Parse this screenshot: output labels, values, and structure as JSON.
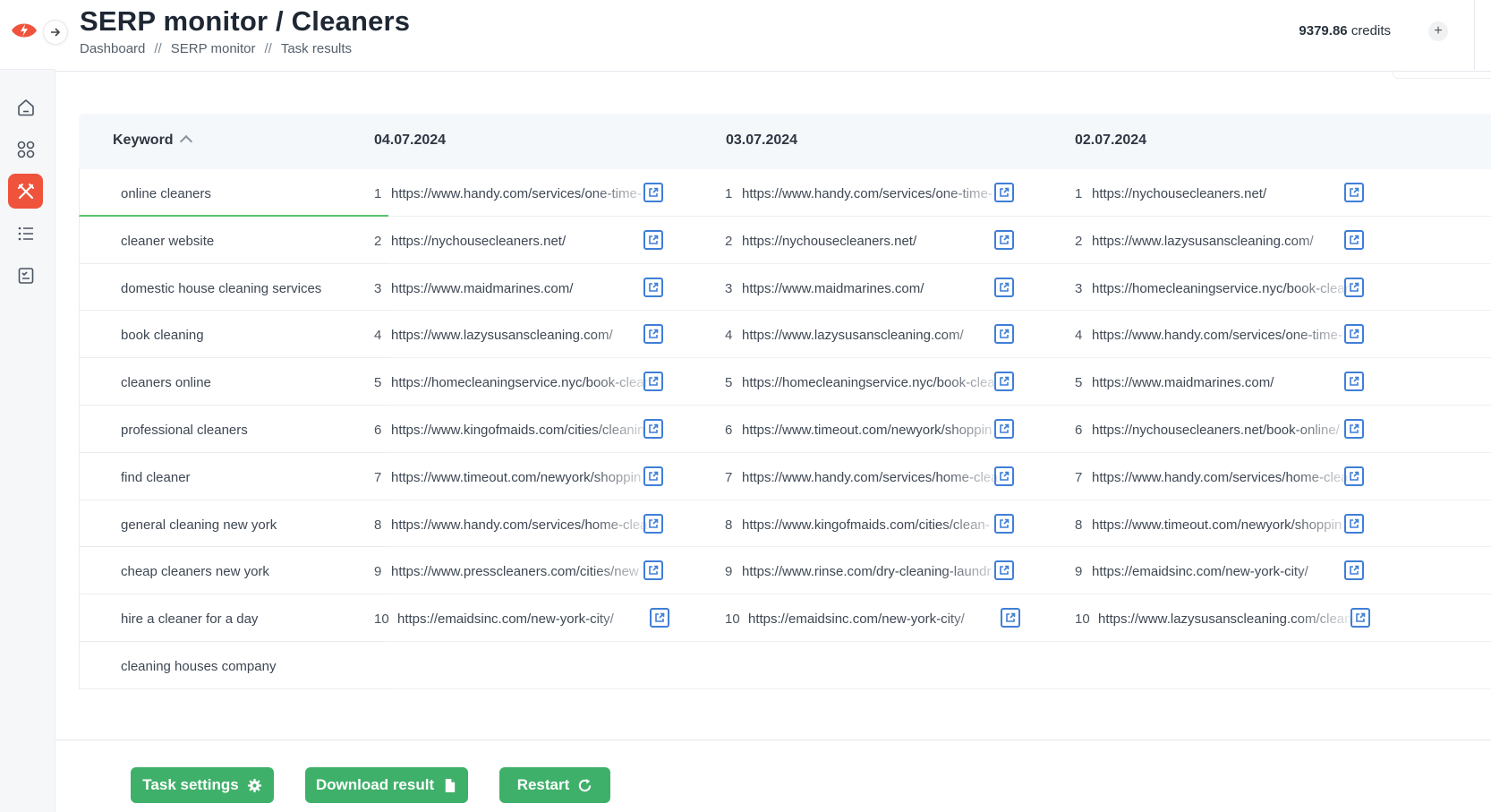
{
  "header": {
    "title": "SERP monitor / Cleaners",
    "breadcrumb": [
      "Dashboard",
      "SERP monitor",
      "Task results"
    ],
    "breadcrumb_separator": "//",
    "credits_value": "9379.86",
    "credits_label": "credits",
    "credits_add": "+"
  },
  "sidebar": {
    "items": [
      {
        "icon": "home-icon"
      },
      {
        "icon": "apps-grid-icon"
      },
      {
        "icon": "tools-icon",
        "active": true
      },
      {
        "icon": "list-icon"
      },
      {
        "icon": "report-icon"
      }
    ]
  },
  "table": {
    "keyword_header": "Keyword",
    "dates": [
      "04.07.2024",
      "03.07.2024",
      "02.07.2024"
    ],
    "keywords": [
      "online cleaners",
      "cleaner website",
      "domestic house cleaning services",
      "book cleaning",
      "cleaners online",
      "professional cleaners",
      "find cleaner",
      "general cleaning new york",
      "cheap cleaners new york",
      "hire a cleaner for a day",
      "cleaning houses company"
    ],
    "results": [
      [
        {
          "pos": "1",
          "url": "https://www.handy.com/services/one-time-"
        },
        {
          "pos": "2",
          "url": "https://nychousecleaners.net/"
        },
        {
          "pos": "3",
          "url": "https://www.maidmarines.com/"
        },
        {
          "pos": "4",
          "url": "https://www.lazysusanscleaning.com/"
        },
        {
          "pos": "5",
          "url": "https://homecleaningservice.nyc/book-clean"
        },
        {
          "pos": "6",
          "url": "https://www.kingofmaids.com/cities/cleanin"
        },
        {
          "pos": "7",
          "url": "https://www.timeout.com/newyork/shoppin"
        },
        {
          "pos": "8",
          "url": "https://www.handy.com/services/home-clea"
        },
        {
          "pos": "9",
          "url": "https://www.presscleaners.com/cities/new"
        },
        {
          "pos": "10",
          "url": "https://emaidsinc.com/new-york-city/"
        }
      ],
      [
        {
          "pos": "1",
          "url": "https://www.handy.com/services/one-time-"
        },
        {
          "pos": "2",
          "url": "https://nychousecleaners.net/"
        },
        {
          "pos": "3",
          "url": "https://www.maidmarines.com/"
        },
        {
          "pos": "4",
          "url": "https://www.lazysusanscleaning.com/"
        },
        {
          "pos": "5",
          "url": "https://homecleaningservice.nyc/book-clea"
        },
        {
          "pos": "6",
          "url": "https://www.timeout.com/newyork/shoppin"
        },
        {
          "pos": "7",
          "url": "https://www.handy.com/services/home-clea"
        },
        {
          "pos": "8",
          "url": "https://www.kingofmaids.com/cities/clean-"
        },
        {
          "pos": "9",
          "url": "https://www.rinse.com/dry-cleaning-laundr"
        },
        {
          "pos": "10",
          "url": "https://emaidsinc.com/new-york-city/"
        }
      ],
      [
        {
          "pos": "1",
          "url": "https://nychousecleaners.net/"
        },
        {
          "pos": "2",
          "url": "https://www.lazysusanscleaning.com/"
        },
        {
          "pos": "3",
          "url": "https://homecleaningservice.nyc/book-clean"
        },
        {
          "pos": "4",
          "url": "https://www.handy.com/services/one-time-"
        },
        {
          "pos": "5",
          "url": "https://www.maidmarines.com/"
        },
        {
          "pos": "6",
          "url": "https://nychousecleaners.net/book-online/"
        },
        {
          "pos": "7",
          "url": "https://www.handy.com/services/home-clea"
        },
        {
          "pos": "8",
          "url": "https://www.timeout.com/newyork/shoppin"
        },
        {
          "pos": "9",
          "url": "https://emaidsinc.com/new-york-city/"
        },
        {
          "pos": "10",
          "url": "https://www.lazysusanscleaning.com/cleani"
        }
      ]
    ]
  },
  "footer": {
    "task_settings": "Task settings",
    "download_result": "Download result",
    "restart": "Restart"
  },
  "colors": {
    "accent": "#f0533c",
    "green_button": "#3fb06a",
    "link_icon": "#3f7fd8",
    "active_underline": "#5cc26b"
  }
}
